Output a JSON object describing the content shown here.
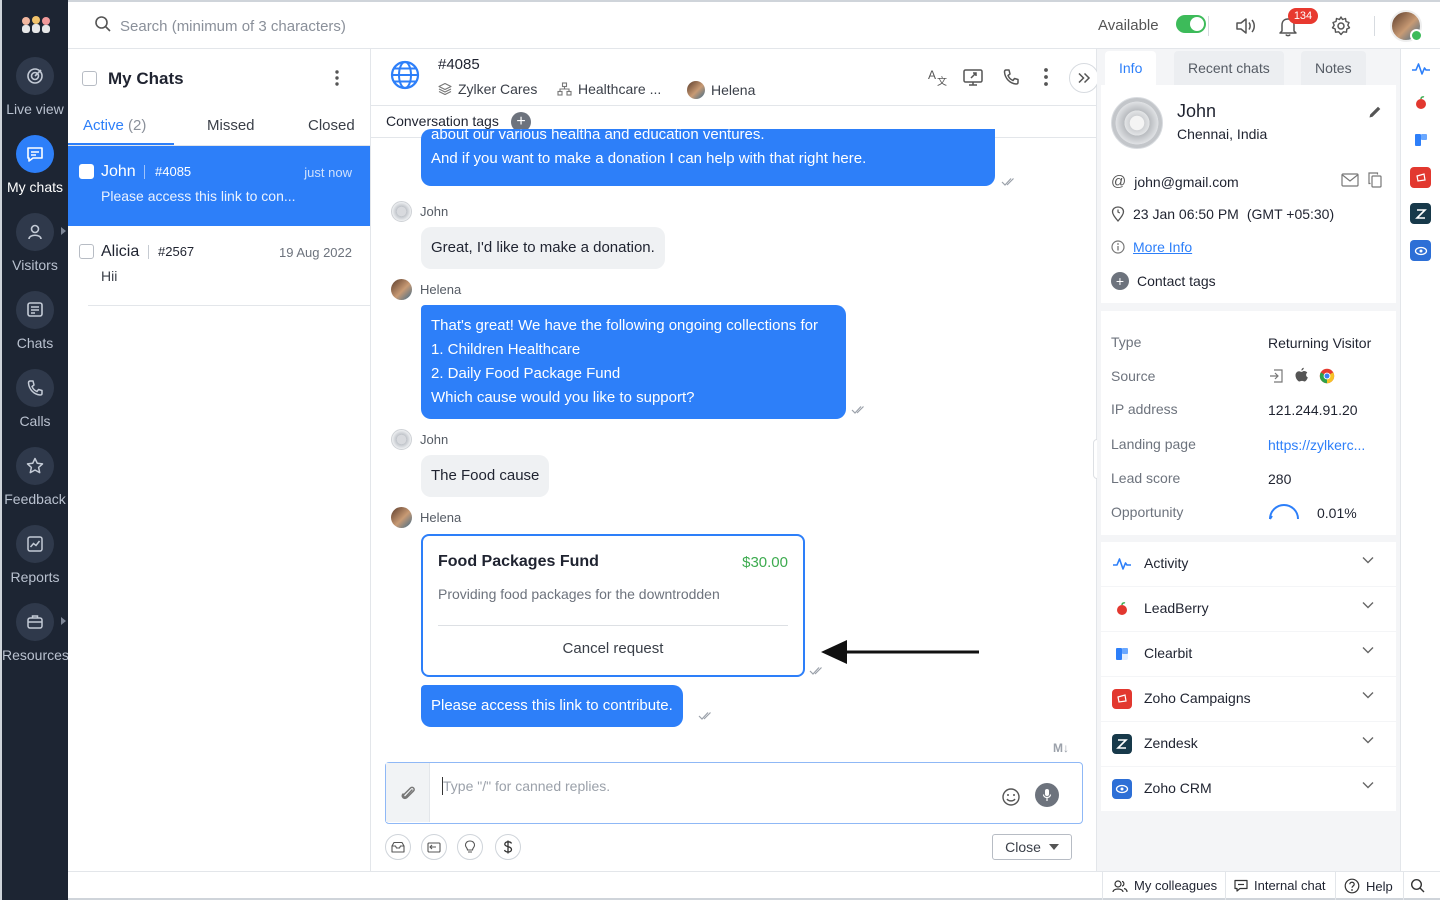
{
  "nav": {
    "items": [
      {
        "label": "Live view",
        "icon": "live-view-icon"
      },
      {
        "label": "My chats",
        "icon": "chat-bubble-icon",
        "active": true
      },
      {
        "label": "Visitors",
        "icon": "person-icon"
      },
      {
        "label": "Chats",
        "icon": "chats-icon"
      },
      {
        "label": "Calls",
        "icon": "phone-icon"
      },
      {
        "label": "Feedback",
        "icon": "star-icon"
      },
      {
        "label": "Reports",
        "icon": "chart-icon"
      },
      {
        "label": "Resources",
        "icon": "briefcase-icon"
      }
    ]
  },
  "topbar": {
    "search_placeholder": "Search (minimum of 3 characters)",
    "availability_label": "Available",
    "notification_count": "134"
  },
  "chatlist": {
    "title": "My Chats",
    "tabs": {
      "active": "Active",
      "active_count": "(2)",
      "missed": "Missed",
      "closed": "Closed"
    },
    "items": [
      {
        "name": "John",
        "id": "#4085",
        "time": "just now",
        "message": "Please access this link to con..."
      },
      {
        "name": "Alicia",
        "id": "#2567",
        "time": "19 Aug 2022",
        "message": "Hii"
      }
    ]
  },
  "conversation": {
    "id": "#4085",
    "brand": "Zylker Cares",
    "department": "Healthcare ...",
    "agent": "Helena",
    "tags_label": "Conversation tags",
    "messages": {
      "m1_line1": "about our various healtha and education ventures.",
      "m1_line2": "And if you want to make a donation I can help with that right here.",
      "m2_sender": "John",
      "m2_text": "Great, I'd like to make a donation.",
      "m3_sender": "Helena",
      "m3_line1": "That's great! We have the following ongoing collections for",
      "m3_line2": "1. Children Healthcare",
      "m3_line3": "2. Daily Food Package Fund",
      "m3_line4": "Which cause would you like to support?",
      "m4_sender": "John",
      "m4_text": "The Food cause",
      "m5_sender": "Helena",
      "m6_text": "Please access this link to contribute."
    },
    "payment": {
      "title": "Food Packages Fund",
      "amount": "$30.00",
      "description": "Providing food packages for the downtrodden",
      "cancel_label": "Cancel request"
    },
    "markdown_label": "M↓",
    "composer_placeholder": "Type \"/\" for canned replies.",
    "close_label": "Close"
  },
  "rightpanel": {
    "tabs": {
      "info": "Info",
      "recent": "Recent chats",
      "notes": "Notes"
    },
    "visitor": {
      "name": "John",
      "location": "Chennai, India",
      "email": "john@gmail.com",
      "datetime": "23 Jan 06:50 PM",
      "timezone": "(GMT +05:30)",
      "more_info": "More Info",
      "contact_tags": "Contact tags"
    },
    "details": [
      {
        "key": "Type",
        "value": "Returning Visitor"
      },
      {
        "key": "Source",
        "value": ""
      },
      {
        "key": "IP address",
        "value": "121.244.91.20"
      },
      {
        "key": "Landing page",
        "value": "https://zylkerc..."
      },
      {
        "key": "Lead score",
        "value": "280"
      },
      {
        "key": "Opportunity",
        "value": "0.01%"
      }
    ],
    "integrations": [
      "Activity",
      "LeadBerry",
      "Clearbit",
      "Zoho Campaigns",
      "Zendesk",
      "Zoho CRM"
    ]
  },
  "footer": {
    "colleagues": "My colleagues",
    "internal_chat": "Internal chat",
    "help": "Help"
  },
  "colors": {
    "accent": "#2d7ff9",
    "nav_bg": "#1d2533",
    "available": "#3dbb5a",
    "badge": "#e8392f",
    "amount": "#3dab4f"
  }
}
